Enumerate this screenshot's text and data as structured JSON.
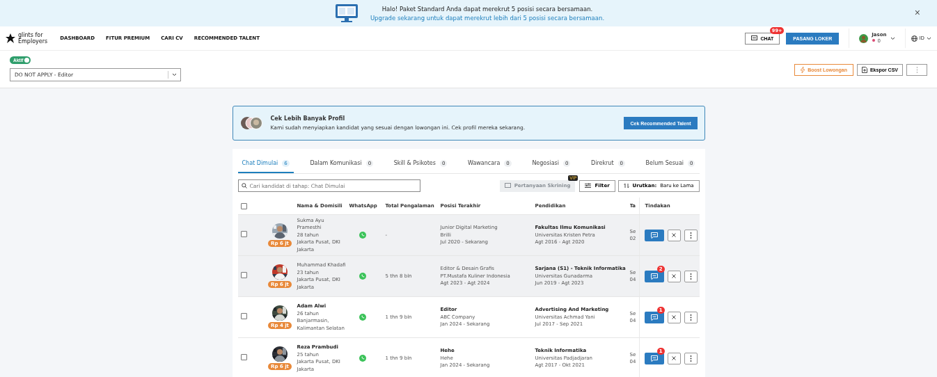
{
  "banner": {
    "line_1": "Halo! Paket Standard Anda dapat merekrut 5 posisi secara bersamaan.",
    "line_2": "Upgrade sekarang untuk dapat merekrut lebih dari 5 posisi secara bersamaan.",
    "close": "×"
  },
  "nav": {
    "logo_line_1": "glints for",
    "logo_line_2": "Employers",
    "items": [
      "DASHBOARD",
      "FITUR PREMIUM",
      "CARI CV",
      "RECOMMENDED TALENT"
    ],
    "chat": "CHAT",
    "chat_badge": "99+",
    "post_job": "PASANG LOKER",
    "user": "Jason",
    "user_points": "0",
    "language": "ID"
  },
  "job": {
    "status": "Aktif",
    "active": true,
    "selected_job": "DO NOT APPLY - Editor",
    "boost": "Boost Lowongan",
    "export": "Ekspor CSV"
  },
  "promo": {
    "title": "Cek Lebih Banyak Profil",
    "text": "Kami sudah menyiapkan kandidat yang sesuai dengan lowongan ini. Cek profil mereka sekarang.",
    "button": "Cek Recommended Talent"
  },
  "tabs": [
    {
      "label": "Chat Dimulai",
      "count": "6",
      "selected": true
    },
    {
      "label": "Dalam Komunikasi",
      "count": "0",
      "selected": false
    },
    {
      "label": "Skill & Psikotes",
      "count": "0",
      "selected": false
    },
    {
      "label": "Wawancara",
      "count": "0",
      "selected": false
    },
    {
      "label": "Negosiasi",
      "count": "0",
      "selected": false
    },
    {
      "label": "Direkrut",
      "count": "0",
      "selected": false
    },
    {
      "label": "Belum Sesuai",
      "count": "0",
      "selected": false
    }
  ],
  "toolbar": {
    "search_placeholder": "Cari kandidat di tahap: Chat Dimulai",
    "screening": "Pertanyaan Skrining",
    "screening_badge": "VIP",
    "filter": "Filter",
    "sort_label": "Urutkan:",
    "sort_value": "Baru ke Lama"
  },
  "table": {
    "all_checked": false,
    "columns": [
      "Nama & Domisili",
      "WhatsApp",
      "Total Pengalaman",
      "Posisi Terakhir",
      "Pendidikan",
      "Ta",
      "Tindakan"
    ],
    "rows": [
      {
        "checked": false,
        "viewed": true,
        "salary": "Rp 6 jt",
        "name": "Sukma Ayu Pramesthi",
        "age": "28 tahun",
        "location": "Jakarta Pusat, DKI Jakarta",
        "experience": "-",
        "position": "Junior Digital Marketing",
        "company": "Brilli",
        "position_period": "Jul 2020 - Sekarang",
        "education": "Fakultas Ilmu Komunikasi",
        "school": "Universitas Kristen Petra",
        "education_period": "Agt 2016 - Agt 2020",
        "column_7": [
          "Se",
          "02"
        ]
      },
      {
        "checked": false,
        "viewed": true,
        "salary": "Rp 6 jt",
        "name": "Muhammad Khadafi",
        "age": "23 tahun",
        "location": "Jakarta Pusat, DKI Jakarta",
        "experience": "5 thn 8 bln",
        "position": "Editor & Desain Grafis",
        "company": "PT.Mustafa Kuliner Indonesia",
        "position_period": "Agt 2023 - Agt 2024",
        "education": "Sarjana (S1) - Teknik Informatika",
        "school": "Universitas Gunadarma",
        "education_period": "Jun 2019 - Agt 2023",
        "column_7": [
          "Se",
          "04"
        ],
        "unread": "2"
      },
      {
        "checked": false,
        "viewed": false,
        "salary": "Rp 4 jt",
        "name": "Adam Alwi",
        "age": "26 tahun",
        "location": "Banjarmasin, Kalimantan Selatan",
        "experience": "1 thn 9 bln",
        "position": "Editor",
        "company": "ABC Company",
        "position_period": "Jan 2024 - Sekarang",
        "education": "Advertising And Marketing",
        "school": "Universitas Achmad Yani",
        "education_period": "Jul 2017 - Sep 2021",
        "column_7": [
          "Se",
          "04"
        ],
        "unread": "1"
      },
      {
        "checked": false,
        "viewed": false,
        "salary": "Rp 6 jt",
        "name": "Reza Prambudi",
        "age": "25 tahun",
        "location": "Jakarta Pusat, DKI Jakarta",
        "experience": "1 thn 9 bln",
        "position": "Hehe",
        "company": "Hehe",
        "position_period": "Jan 2024 - Sekarang",
        "education": "Teknik Informatika",
        "school": "Universitas Padjadjaran",
        "education_period": "Agt 2017 - Okt 2021",
        "column_7": [
          "Se",
          "04"
        ],
        "unread": "1"
      }
    ]
  }
}
